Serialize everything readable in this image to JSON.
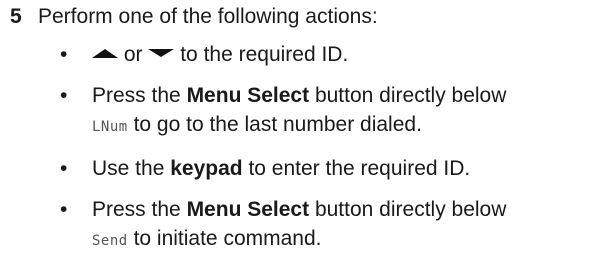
{
  "step": {
    "number": "5",
    "text": "Perform one of the following actions:"
  },
  "bullets": {
    "b1": {
      "connector": "or",
      "suffix": "to the required ID."
    },
    "b2": {
      "prefix": "Press the",
      "bold": "Menu Select",
      "suffix": "button directly below",
      "lcd": "LNum",
      "line2": "to go to the last number dialed."
    },
    "b3": {
      "prefix": "Use the",
      "bold": "keypad",
      "suffix": "to enter the required ID."
    },
    "b4": {
      "prefix": "Press the",
      "bold": "Menu Select",
      "suffix": "button directly below",
      "lcd": "Send",
      "line2": "to initiate command."
    },
    "bullet_glyph": "•"
  },
  "icons": {
    "up": "up-arrow-icon",
    "down": "down-arrow-icon"
  }
}
